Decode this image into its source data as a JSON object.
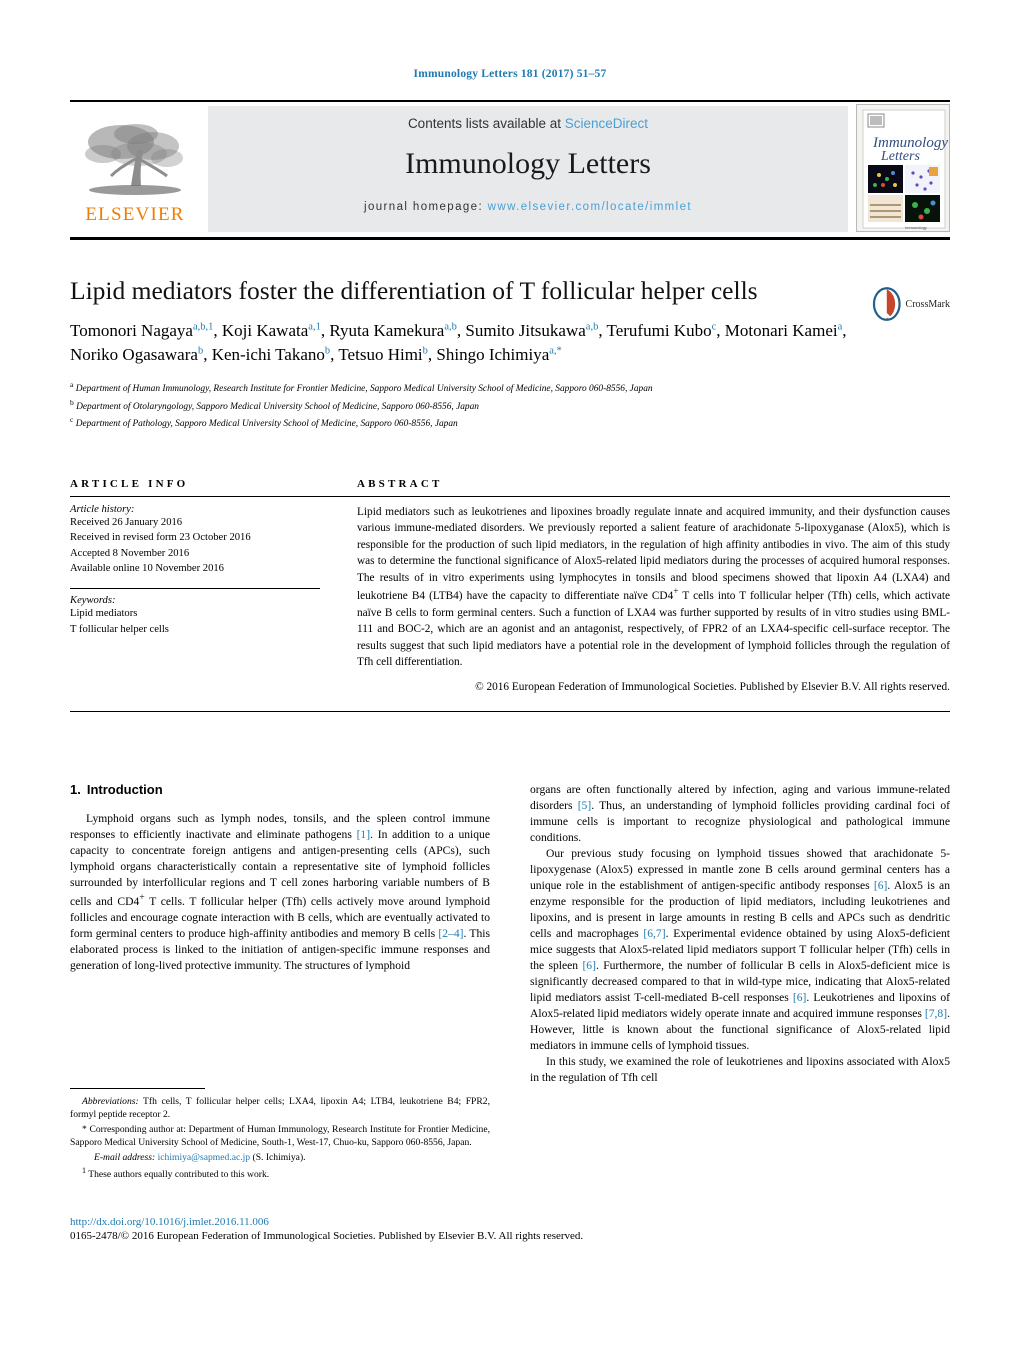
{
  "running_head": "Immunology Letters 181 (2017) 51–57",
  "masthead": {
    "contents_prefix": "Contents lists available at ",
    "sciencedirect": "ScienceDirect",
    "journal_title": "Immunology Letters",
    "homepage_prefix": "journal homepage: ",
    "homepage_url": "www.elsevier.com/locate/immlet",
    "publisher_wordmark": "ELSEVIER",
    "accent_orange": "#f07d00",
    "link_blue": "#4a9fd4"
  },
  "article": {
    "title": "Lipid mediators foster the differentiation of T follicular helper cells",
    "crossmark_label": "CrossMark",
    "authors": [
      {
        "name": "Tomonori Nagaya",
        "sup": "a,b,1",
        "sep": ", "
      },
      {
        "name": "Koji Kawata",
        "sup": "a,1",
        "sep": ", "
      },
      {
        "name": "Ryuta Kamekura",
        "sup": "a,b",
        "sep": ", "
      },
      {
        "name": "Sumito Jitsukawa",
        "sup": "a,b",
        "sep": ", "
      },
      {
        "name": "Terufumi Kubo",
        "sup": "c",
        "sep": ", "
      },
      {
        "name": "Motonari Kamei",
        "sup": "a",
        "sep": ", "
      },
      {
        "name": "Noriko Ogasawara",
        "sup": "b",
        "sep": ", "
      },
      {
        "name": "Ken-ichi Takano",
        "sup": "b",
        "sep": ", "
      },
      {
        "name": "Tetsuo Himi",
        "sup": "b",
        "sep": ", "
      },
      {
        "name": "Shingo Ichimiya",
        "sup": "a,*",
        "sep": ""
      }
    ],
    "affiliations": [
      {
        "marker": "a",
        "text": "Department of Human Immunology, Research Institute for Frontier Medicine, Sapporo Medical University School of Medicine, Sapporo 060-8556, Japan"
      },
      {
        "marker": "b",
        "text": "Department of Otolaryngology, Sapporo Medical University School of Medicine, Sapporo 060-8556, Japan"
      },
      {
        "marker": "c",
        "text": "Department of Pathology, Sapporo Medical University School of Medicine, Sapporo 060-8556, Japan"
      }
    ]
  },
  "article_info": {
    "heading": "ARTICLE INFO",
    "history_label": "Article history:",
    "history": [
      "Received 26 January 2016",
      "Received in revised form 23 October 2016",
      "Accepted 8 November 2016",
      "Available online 10 November 2016"
    ],
    "keywords_label": "Keywords:",
    "keywords": [
      "Lipid mediators",
      "T follicular helper cells"
    ]
  },
  "abstract": {
    "heading": "ABSTRACT",
    "text": "Lipid mediators such as leukotrienes and lipoxines broadly regulate innate and acquired immunity, and their dysfunction causes various immune-mediated disorders. We previously reported a salient feature of arachidonate 5-lipoxyganase (Alox5), which is responsible for the production of such lipid mediators, in the regulation of high affinity antibodies in vivo. The aim of this study was to determine the functional significance of Alox5-related lipid mediators during the processes of acquired humoral responses. The results of in vitro experiments using lymphocytes in tonsils and blood specimens showed that lipoxin A4 (LXA4) and leukotriene B4 (LTB4) have the capacity to differentiate naïve CD4+ T cells into T follicular helper (Tfh) cells, which activate naïve B cells to form germinal centers. Such a function of LXA4 was further supported by results of in vitro studies using BML-111 and BOC-2, which are an agonist and an antagonist, respectively, of FPR2 of an LXA4-specific cell-surface receptor. The results suggest that such lipid mediators have a potential role in the development of lymphoid follicles through the regulation of Tfh cell differentiation.",
    "copyright": "© 2016 European Federation of Immunological Societies. Published by Elsevier B.V. All rights reserved."
  },
  "body": {
    "section_number": "1.",
    "section_title": "Introduction",
    "left_paragraphs": [
      "Lymphoid organs such as lymph nodes, tonsils, and the spleen control immune responses to efficiently inactivate and eliminate pathogens [1]. In addition to a unique capacity to concentrate foreign antigens and antigen-presenting cells (APCs), such lymphoid organs characteristically contain a representative site of lymphoid follicles surrounded by interfollicular regions and T cell zones harboring variable numbers of B cells and CD4+ T cells. T follicular helper (Tfh) cells actively move around lymphoid follicles and encourage cognate interaction with B cells, which are eventually activated to form germinal centers to produce high-affinity antibodies and memory B cells [2–4]. This elaborated process is linked to the initiation of antigen-specific immune responses and generation of long-lived protective immunity. The structures of lymphoid"
    ],
    "right_paragraphs": [
      "organs are often functionally altered by infection, aging and various immune-related disorders [5]. Thus, an understanding of lymphoid follicles providing cardinal foci of immune cells is important to recognize physiological and pathological immune conditions.",
      "Our previous study focusing on lymphoid tissues showed that arachidonate 5-lipoxygenase (Alox5) expressed in mantle zone B cells around germinal centers has a unique role in the establishment of antigen-specific antibody responses [6]. Alox5 is an enzyme responsible for the production of lipid mediators, including leukotrienes and lipoxins, and is present in large amounts in resting B cells and APCs such as dendritic cells and macrophages [6,7]. Experimental evidence obtained by using Alox5-deficient mice suggests that Alox5-related lipid mediators support T follicular helper (Tfh) cells in the spleen [6]. Furthermore, the number of follicular B cells in Alox5-deficient mice is significantly decreased compared to that in wild-type mice, indicating that Alox5-related lipid mediators assist T-cell-mediated B-cell responses [6]. Leukotrienes and lipoxins of Alox5-related lipid mediators widely operate innate and acquired immune responses [7,8]. However, little is known about the functional significance of Alox5-related lipid mediators in immune cells of lymphoid tissues.",
      "In this study, we examined the role of leukotrienes and lipoxins associated with Alox5 in the regulation of Tfh cell"
    ]
  },
  "footnotes": {
    "abbreviations_label": "Abbreviations:",
    "abbreviations_text": "Tfh cells, T follicular helper cells; LXA4, lipoxin A4; LTB4, leukotriene B4; FPR2, formyl peptide receptor 2.",
    "corresponding_marker": "*",
    "corresponding_text": "Corresponding author at: Department of Human Immunology, Research Institute for Frontier Medicine, Sapporo Medical University School of Medicine, South-1, West-17, Chuo-ku, Sapporo 060-8556, Japan.",
    "email_label": "E-mail address:",
    "email": "ichimiya@sapmed.ac.jp",
    "email_owner": "(S. Ichimiya).",
    "equal_contrib_marker": "1",
    "equal_contrib_text": "These authors equally contributed to this work."
  },
  "footer": {
    "doi": "http://dx.doi.org/10.1016/j.imlet.2016.11.006",
    "issn_line": "0165-2478/© 2016 European Federation of Immunological Societies. Published by Elsevier B.V. All rights reserved."
  }
}
